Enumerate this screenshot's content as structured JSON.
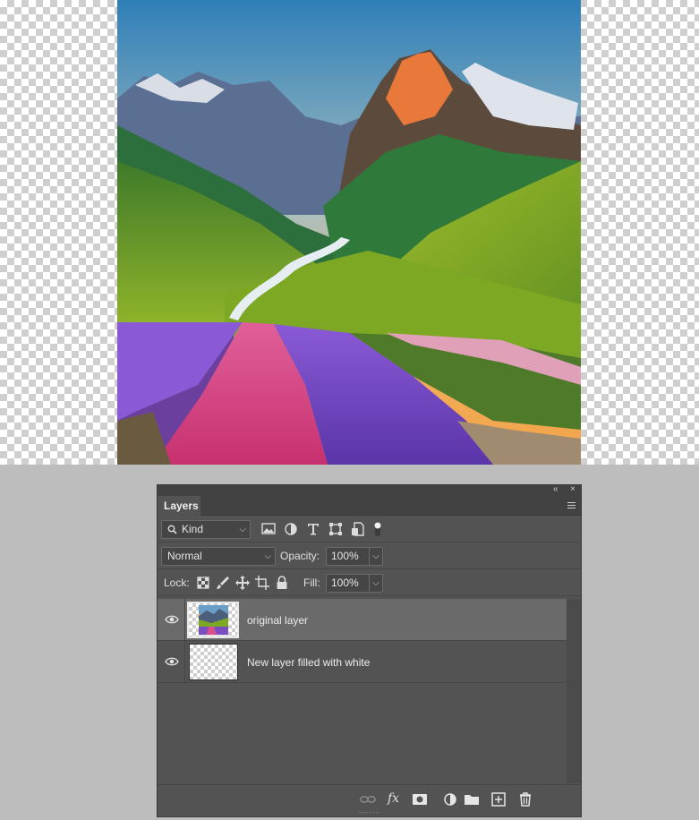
{
  "panel": {
    "collapse_glyph": "«",
    "close_glyph": "×",
    "tab_label": "Layers",
    "menu_icon": "hamburger-icon"
  },
  "filter_row": {
    "kind_label": "Kind",
    "search_icon": "search-icon",
    "filter_icons": [
      "image-filter-icon",
      "adjustment-filter-icon",
      "type-filter-icon",
      "shape-filter-icon",
      "smart-object-filter-icon",
      "filter-toggle-icon"
    ]
  },
  "blend_row": {
    "blend_mode": "Normal",
    "opacity_label": "Opacity:",
    "opacity_value": "100%"
  },
  "lock_row": {
    "lock_label": "Lock:",
    "lock_icons": [
      "lock-transparent-pixels-icon",
      "lock-image-pixels-icon",
      "lock-position-icon",
      "lock-artboard-icon",
      "lock-all-icon"
    ],
    "fill_label": "Fill:",
    "fill_value": "100%"
  },
  "layers": [
    {
      "name": "original layer",
      "visible": true,
      "selected": true
    },
    {
      "name": "New layer filled with white",
      "visible": true,
      "selected": false
    }
  ],
  "footer": {
    "icons": [
      "link-layers-icon",
      "fx-icon",
      "add-mask-icon",
      "new-adjustment-icon",
      "new-group-icon",
      "new-layer-icon",
      "delete-icon"
    ],
    "fx_label": "fx"
  }
}
